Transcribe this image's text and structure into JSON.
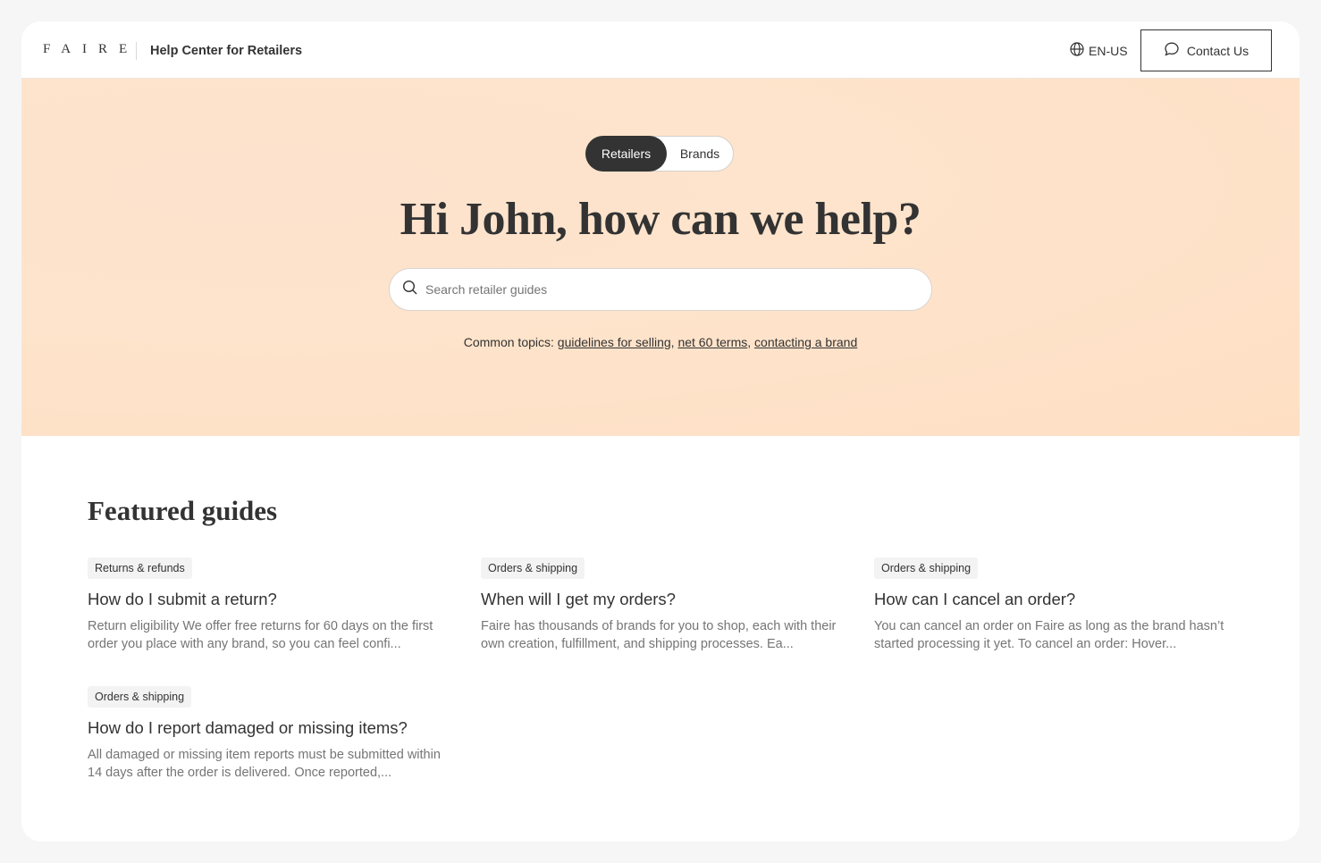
{
  "header": {
    "logo": "FAIRE",
    "title": "Help Center for Retailers",
    "lang": "EN-US",
    "contact_label": "Contact Us"
  },
  "hero": {
    "toggle": {
      "active": "Retailers",
      "inactive": "Brands"
    },
    "heading": "Hi John, how can we help?",
    "search_placeholder": "Search retailer guides",
    "topics_prefix": "Common topics: ",
    "topics": [
      "guidelines for selling",
      "net 60 terms",
      "contacting a brand"
    ],
    "separator": ", "
  },
  "featured": {
    "title": "Featured guides",
    "guides": [
      {
        "tag": "Returns & refunds",
        "title": "How do I submit a return?",
        "desc": "Return eligibility We offer free returns for 60 days on the first order you place with any brand, so you can feel confi..."
      },
      {
        "tag": "Orders & shipping",
        "title": "When will I get my orders?",
        "desc": "Faire has thousands of brands for you to shop, each with their own creation, fulfillment, and shipping processes. Ea..."
      },
      {
        "tag": "Orders & shipping",
        "title": "How can I cancel an order?",
        "desc": "You can cancel an order on Faire as long as the brand hasn’t started processing it yet. To cancel an order: Hover..."
      },
      {
        "tag": "Orders & shipping",
        "title": "How do I report damaged or missing items?",
        "desc": "All damaged or missing item reports must be submitted within 14 days after the order is delivered. Once reported,..."
      }
    ]
  },
  "colors": {
    "hero_bg": "#fee4cc",
    "dark": "#333333",
    "muted": "#757575",
    "tag_bg": "#f3f3f3"
  },
  "icons": [
    "globe-icon",
    "chat-bubble-icon",
    "search-icon"
  ]
}
